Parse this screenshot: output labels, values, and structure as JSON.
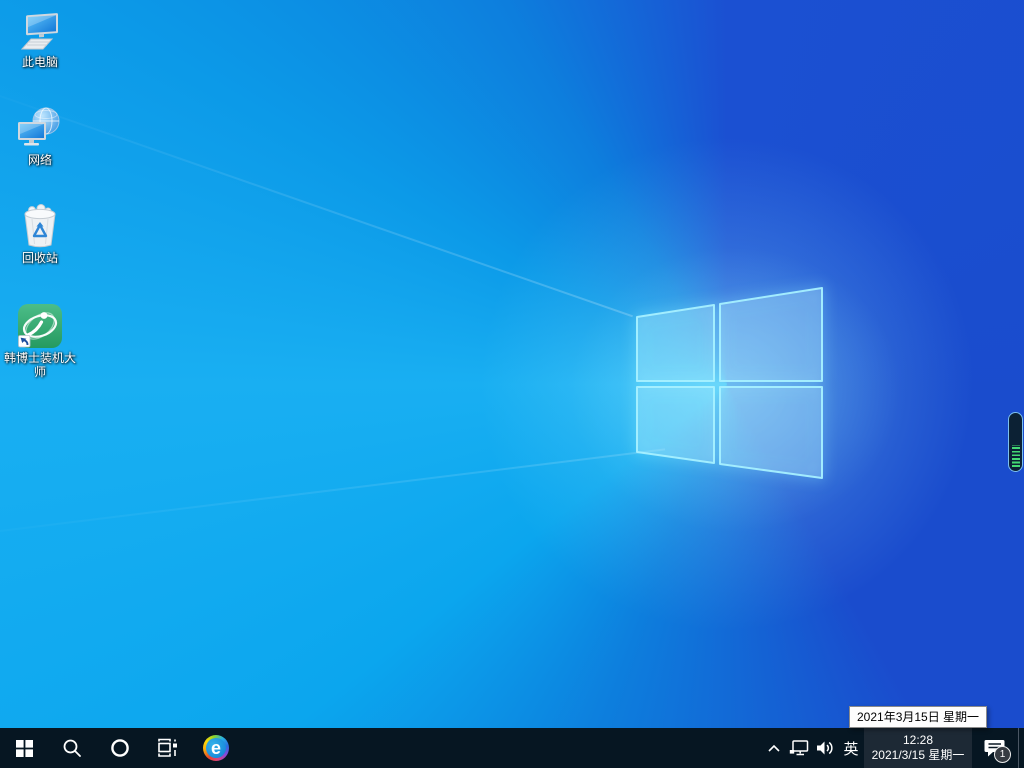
{
  "desktop": {
    "icons": [
      {
        "label": "此电脑"
      },
      {
        "label": "网络"
      },
      {
        "label": "回收站"
      },
      {
        "label": "韩博士装机大师"
      }
    ]
  },
  "tooltip": {
    "text": "2021年3月15日 星期一"
  },
  "taskbar": {
    "edge_letter": "e",
    "tray": {
      "ime_label": "英",
      "clock": {
        "time": "12:28",
        "date": "2021/3/15 星期一"
      },
      "action_center": {
        "badge": "1"
      }
    }
  },
  "colors": {
    "wallpaper_azure": "#0ba6ee",
    "wallpaper_deep_blue": "#1b50d2",
    "taskbar": "#061622",
    "clock_hover": "#1d2935",
    "logo_edge": "#a6f0ff",
    "volume_level_green": "#43da74",
    "hanboshi_green": "#2fa66e"
  }
}
